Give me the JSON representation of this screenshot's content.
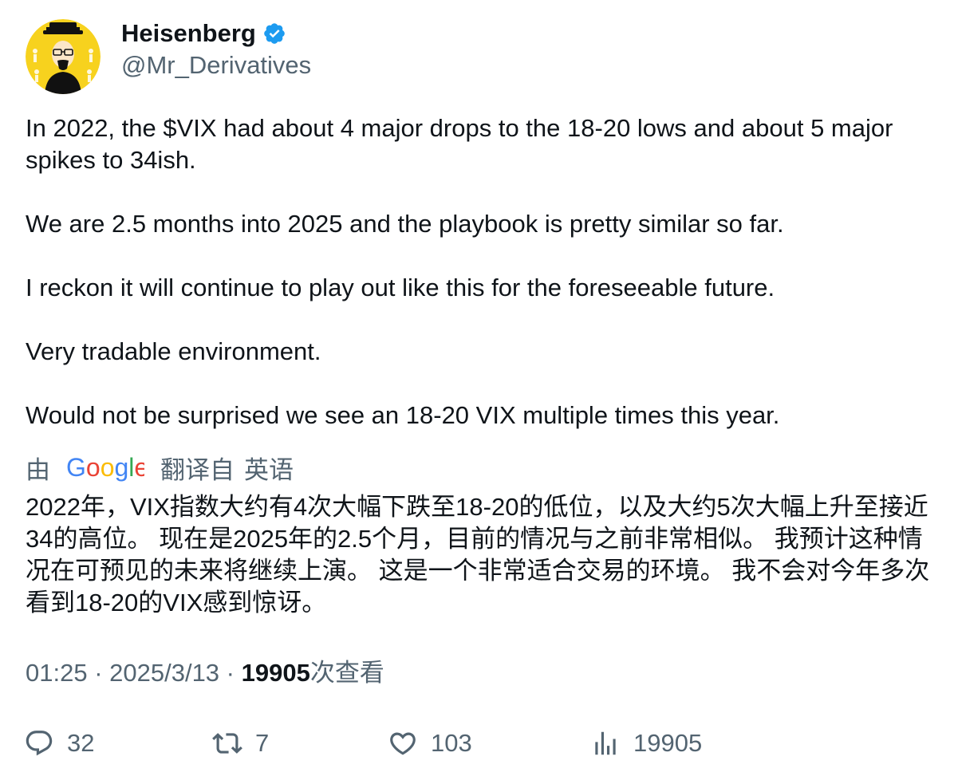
{
  "author": {
    "display_name": "Heisenberg",
    "handle": "@Mr_Derivatives",
    "verified": true,
    "verified_icon": "verified-badge-icon",
    "accent_color": "#1d9bf0"
  },
  "tweet": {
    "paragraphs": [
      "In 2022, the $VIX had about 4 major drops to the 18-20 lows and about 5 major spikes to 34ish.",
      "We are 2.5 months into 2025 and the playbook is pretty similar so far.",
      "I reckon it will continue to play out like this for the foreseeable future.",
      "Very tradable environment.",
      "Would not be surprised we see an 18-20 VIX multiple times this year."
    ]
  },
  "translation": {
    "by_label": "由",
    "provider": "Google",
    "translated_from_label": "翻译自",
    "source_language": "英语",
    "text": "2022年，VIX指数大约有4次大幅下跌至18-20的低位，以及大约5次大幅上升至接近34的高位。 现在是2025年的2.5个月，目前的情况与之前非常相似。 我预计这种情况在可预见的未来将继续上演。 这是一个非常适合交易的环境。 我不会对今年多次看到18-20的VIX感到惊讶。"
  },
  "meta": {
    "time": "01:25",
    "separator": " · ",
    "date": "2025/3/13",
    "views_count": "19905",
    "views_label": "次查看"
  },
  "actions": {
    "replies": {
      "icon": "reply-icon",
      "count": "32"
    },
    "retweets": {
      "icon": "retweet-icon",
      "count": "7"
    },
    "likes": {
      "icon": "heart-icon",
      "count": "103"
    },
    "views": {
      "icon": "analytics-icon",
      "count": "19905"
    }
  },
  "colors": {
    "text_primary": "#0f1419",
    "text_secondary": "#536471",
    "avatar_background": "#f7d21e"
  }
}
